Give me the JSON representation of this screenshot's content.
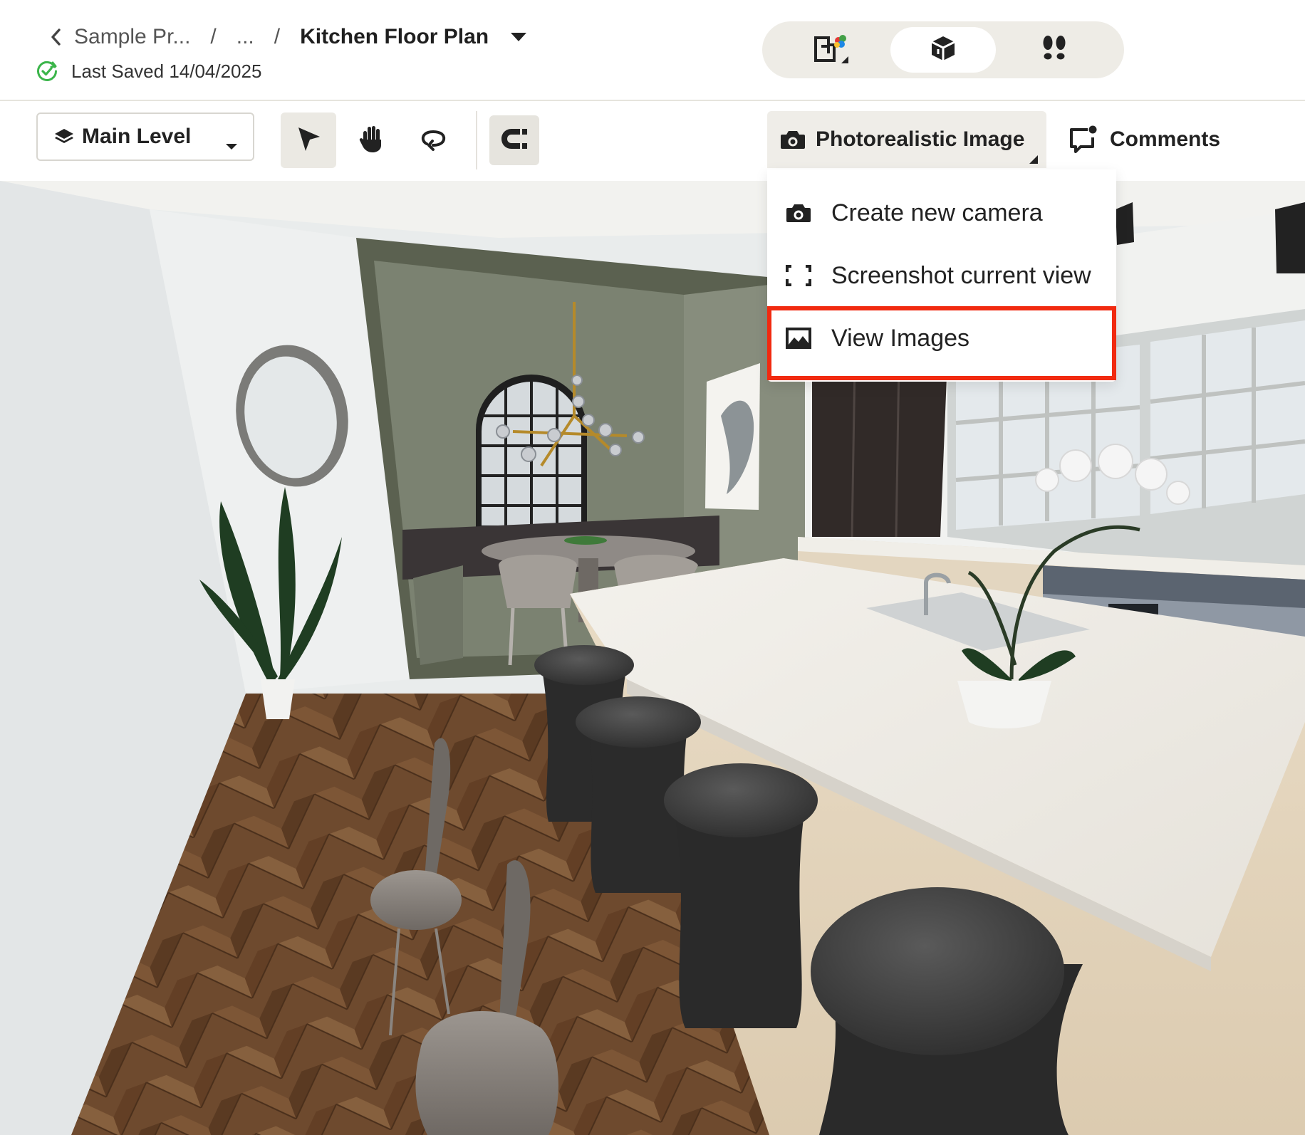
{
  "header": {
    "breadcrumb": {
      "project": "Sample Pr...",
      "ellipsis": "...",
      "separator": "/",
      "current": "Kitchen Floor Plan"
    },
    "saved_status": "Last Saved 14/04/2025"
  },
  "view_modes": [
    {
      "icon": "floor-plan-2d-icon",
      "active": false
    },
    {
      "icon": "3d-box-icon",
      "active": true
    },
    {
      "icon": "footsteps-walkthrough-icon",
      "active": false
    }
  ],
  "toolbar": {
    "level": "Main Level",
    "tools": [
      {
        "icon": "select-arrow-icon",
        "active": true
      },
      {
        "icon": "pan-hand-icon",
        "active": false
      },
      {
        "icon": "orbit-rotate-icon",
        "active": false
      }
    ],
    "snap_icon": "magnet-snap-icon",
    "photo_button": "Photorealistic Image",
    "comments_button": "Comments"
  },
  "photo_menu": {
    "items": [
      {
        "label": "Create new camera",
        "icon": "camera-icon"
      },
      {
        "label": "Screenshot current view",
        "icon": "screenshot-frame-icon"
      },
      {
        "label": "View Images",
        "icon": "image-icon",
        "highlighted": true
      }
    ],
    "highlight_color": "#f12a10"
  },
  "colors": {
    "accent_green": "#3bb54a",
    "toolbar_active": "#ebe9e3",
    "view_switch_bg": "#eeece6"
  }
}
